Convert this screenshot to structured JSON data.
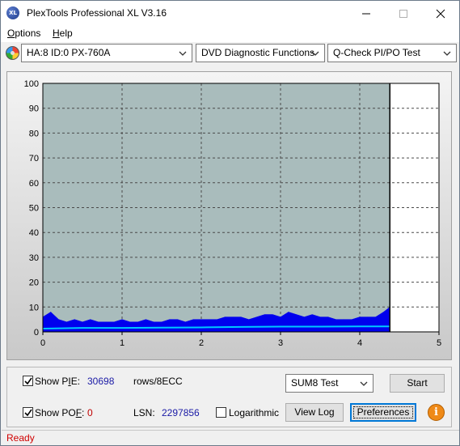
{
  "window": {
    "title": "PlexTools Professional XL V3.16",
    "app_icon_text": "XL"
  },
  "menu": {
    "items": [
      {
        "label": "Options",
        "accel": "O"
      },
      {
        "label": "Help",
        "accel": "H"
      }
    ]
  },
  "toolbar": {
    "drive_select": "HA:8 ID:0  PX-760A",
    "function_select": "DVD Diagnostic Functions",
    "test_select": "Q-Check PI/PO Test"
  },
  "chart_data": {
    "type": "area",
    "x_ticks": [
      "0",
      "1",
      "2",
      "3",
      "4",
      "5"
    ],
    "y_ticks": [
      "0",
      "10",
      "20",
      "30",
      "40",
      "50",
      "60",
      "70",
      "80",
      "90",
      "100"
    ],
    "xlim": [
      0,
      5
    ],
    "ylim": [
      0,
      100
    ],
    "grid": true,
    "plot_background": "#a9bcbc",
    "unused_background": "#ffffff",
    "end_marker_x": 4.38,
    "series": [
      {
        "name": "PIE",
        "color": "#0000ee",
        "x": [
          0.0,
          0.1,
          0.2,
          0.3,
          0.4,
          0.5,
          0.6,
          0.7,
          0.8,
          0.9,
          1.0,
          1.1,
          1.2,
          1.3,
          1.4,
          1.5,
          1.6,
          1.7,
          1.8,
          1.9,
          2.0,
          2.1,
          2.2,
          2.3,
          2.4,
          2.5,
          2.6,
          2.7,
          2.8,
          2.9,
          3.0,
          3.1,
          3.2,
          3.3,
          3.4,
          3.5,
          3.6,
          3.7,
          3.8,
          3.9,
          4.0,
          4.1,
          4.2,
          4.3,
          4.38
        ],
        "y": [
          6,
          8,
          5,
          4,
          5,
          4,
          5,
          4,
          4,
          4,
          5,
          4,
          4,
          5,
          4,
          4,
          5,
          5,
          4,
          5,
          5,
          5,
          5,
          6,
          6,
          6,
          5,
          6,
          7,
          7,
          6,
          8,
          7,
          6,
          7,
          6,
          6,
          5,
          5,
          5,
          6,
          6,
          6,
          8,
          10
        ]
      },
      {
        "name": "PIF",
        "color": "#00c8ff",
        "x": [
          0.0,
          0.5,
          1.0,
          1.5,
          2.0,
          2.5,
          3.0,
          3.5,
          4.0,
          4.38
        ],
        "y": [
          1.3,
          1.6,
          1.6,
          1.7,
          1.8,
          2.0,
          2.1,
          2.1,
          2.2,
          2.2
        ]
      }
    ]
  },
  "controls": {
    "show_pie_label": "Show PIE:",
    "show_pie_accel": "I",
    "pie_value": "30698",
    "rows_label": "rows/8ECC",
    "show_poe_label": "Show POF:",
    "show_poe_accel": "F",
    "poe_value": "0",
    "lsn_label": "LSN:",
    "lsn_value": "2297856",
    "logarithmic_label": "Logarithmic",
    "sum_select": "SUM8 Test",
    "start_button": "Start",
    "view_log_button": "View Log",
    "preferences_button": "Preferences",
    "info_button": "i",
    "show_pie_checked": true,
    "show_poe_checked": true,
    "logarithmic_checked": false
  },
  "status": {
    "text": "Ready"
  }
}
